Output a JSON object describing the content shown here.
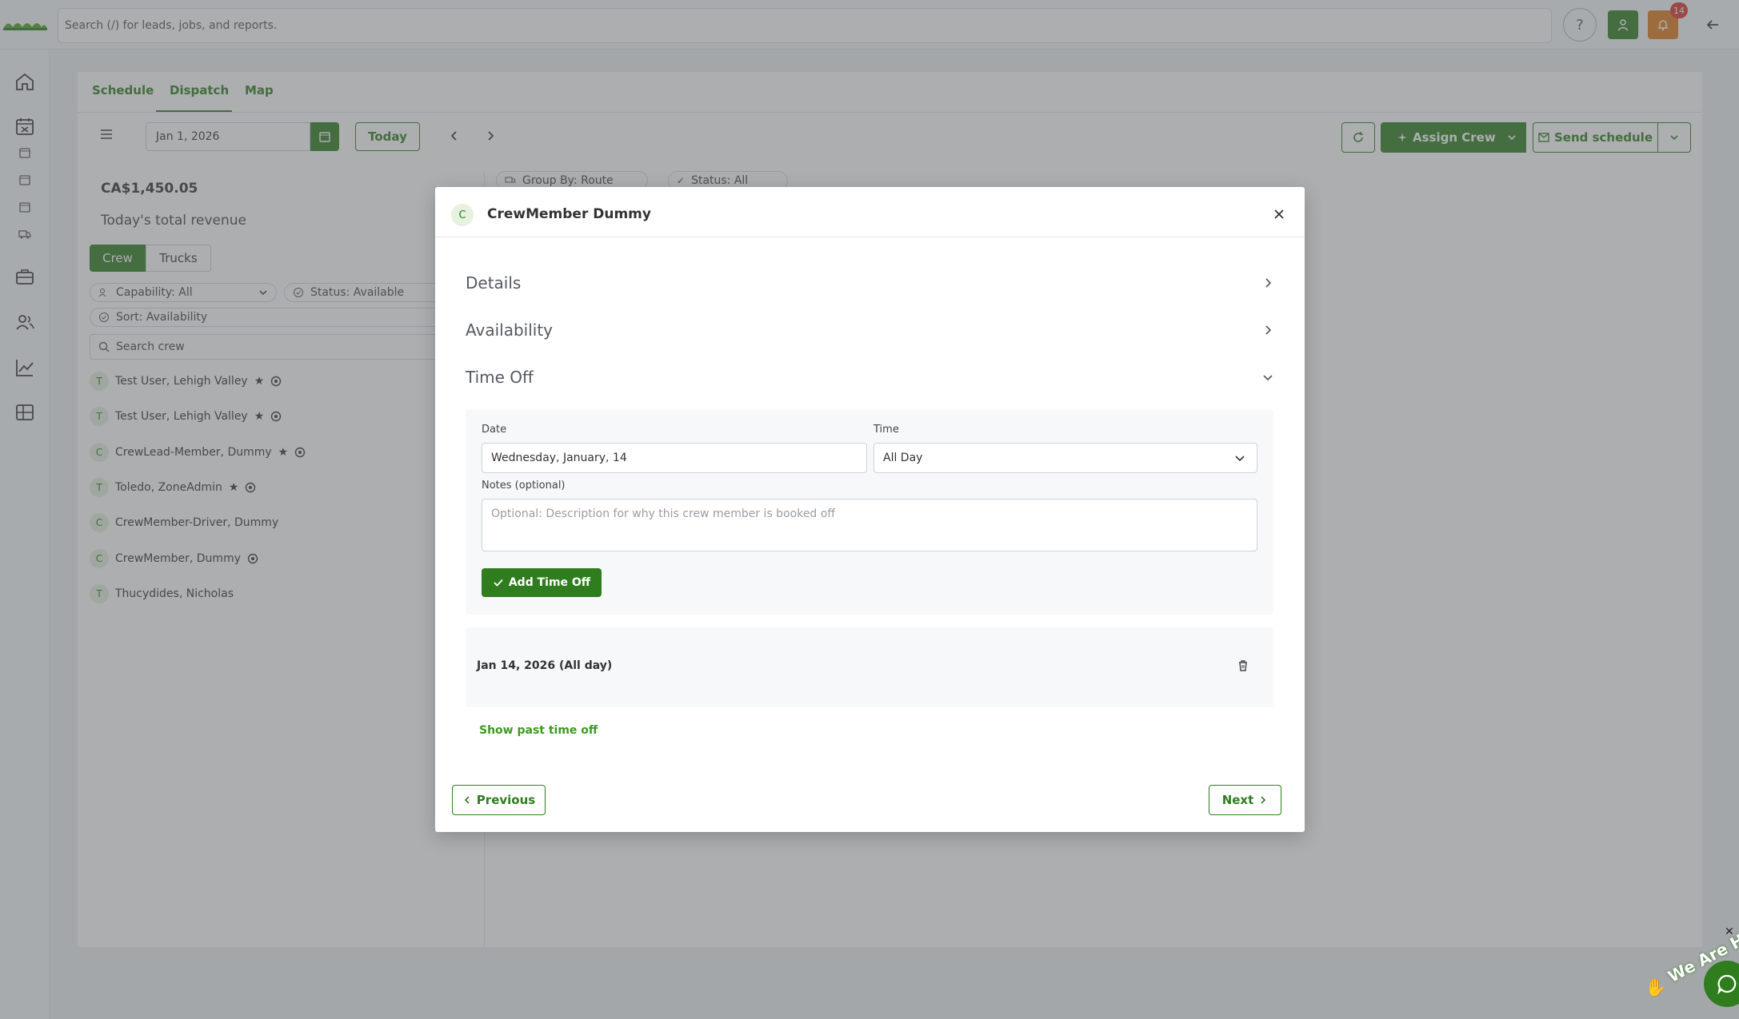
{
  "colors": {
    "brand": "#2f7d1e",
    "accent_orange": "#e07b1a",
    "badge_red": "#d9342b"
  },
  "topbar": {
    "search_placeholder": "Search (/) for leads, jobs, and reports.",
    "notification_count": "14"
  },
  "tabs": [
    {
      "label": "Schedule"
    },
    {
      "label": "Dispatch"
    },
    {
      "label": "Map"
    }
  ],
  "toolbar": {
    "date": "Jan 1, 2026",
    "today_label": "Today",
    "assign_crew_label": "Assign Crew",
    "send_schedule_label": "Send schedule"
  },
  "summary": {
    "revenue": "CA$1,450.05",
    "revenue_label": "Today's total revenue"
  },
  "crew_tabs": [
    {
      "label": "Crew"
    },
    {
      "label": "Trucks"
    }
  ],
  "filters": {
    "capability": "Capability: All",
    "status": "Status: Available",
    "sort": "Sort: Availability",
    "search_placeholder": "Search crew",
    "group_by": "Group By: Route",
    "status_all": "Status: All"
  },
  "crew_list": [
    {
      "initial": "T",
      "name": "Test User, Lehigh Valley",
      "star": true,
      "badge": true
    },
    {
      "initial": "T",
      "name": "Test User, Lehigh Valley",
      "star": true,
      "badge": true
    },
    {
      "initial": "C",
      "name": "CrewLead-Member, Dummy",
      "star": true,
      "badge": true
    },
    {
      "initial": "T",
      "name": "Toledo, ZoneAdmin",
      "star": true,
      "badge": true
    },
    {
      "initial": "C",
      "name": "CrewMember-Driver, Dummy",
      "star": false,
      "badge": false
    },
    {
      "initial": "C",
      "name": "CrewMember, Dummy",
      "star": false,
      "badge": true
    },
    {
      "initial": "T",
      "name": "Thucydides, Nicholas",
      "star": false,
      "badge": false
    }
  ],
  "modal": {
    "avatar_initial": "C",
    "title": "CrewMember Dummy",
    "sections": {
      "details": "Details",
      "availability": "Availability",
      "time_off": "Time Off"
    },
    "form": {
      "date_label": "Date",
      "date_value": "Wednesday, January, 14",
      "time_label": "Time",
      "time_value": "All Day",
      "notes_label": "Notes (optional)",
      "notes_placeholder": "Optional: Description for why this crew member is booked off",
      "add_button": "Add Time Off"
    },
    "entries": [
      {
        "label": "Jan 14, 2026 (All day)"
      }
    ],
    "show_past_label": "Show past time off",
    "previous_label": "Previous",
    "next_label": "Next"
  },
  "chat_widget": {
    "text": "We Are Here!"
  }
}
